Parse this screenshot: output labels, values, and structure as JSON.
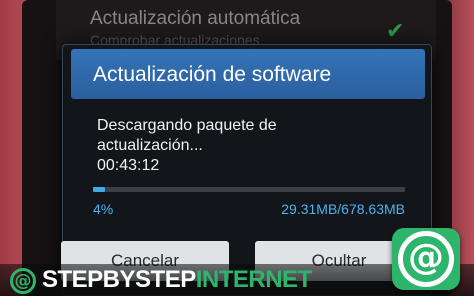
{
  "background": {
    "setting_title": "Actualización automática",
    "setting_subtitle": "Comprobar actualizaciones",
    "check_icon": "check-icon"
  },
  "dialog": {
    "title": "Actualización de software",
    "message_line1": "Descargando paquete de",
    "message_line2": "actualización...",
    "elapsed": "00:43:12",
    "progress_fraction": 0.04,
    "percent_label": "4%",
    "size_label": "29.31MB/678.63MB",
    "cancel_label": "Cancelar",
    "hide_label": "Ocultar"
  },
  "watermark": {
    "brand_part1": "STEPBYSTEP",
    "brand_part2": "INTERNET",
    "logo_icon": "at-sign-icon",
    "accent_color": "#2db56b"
  }
}
